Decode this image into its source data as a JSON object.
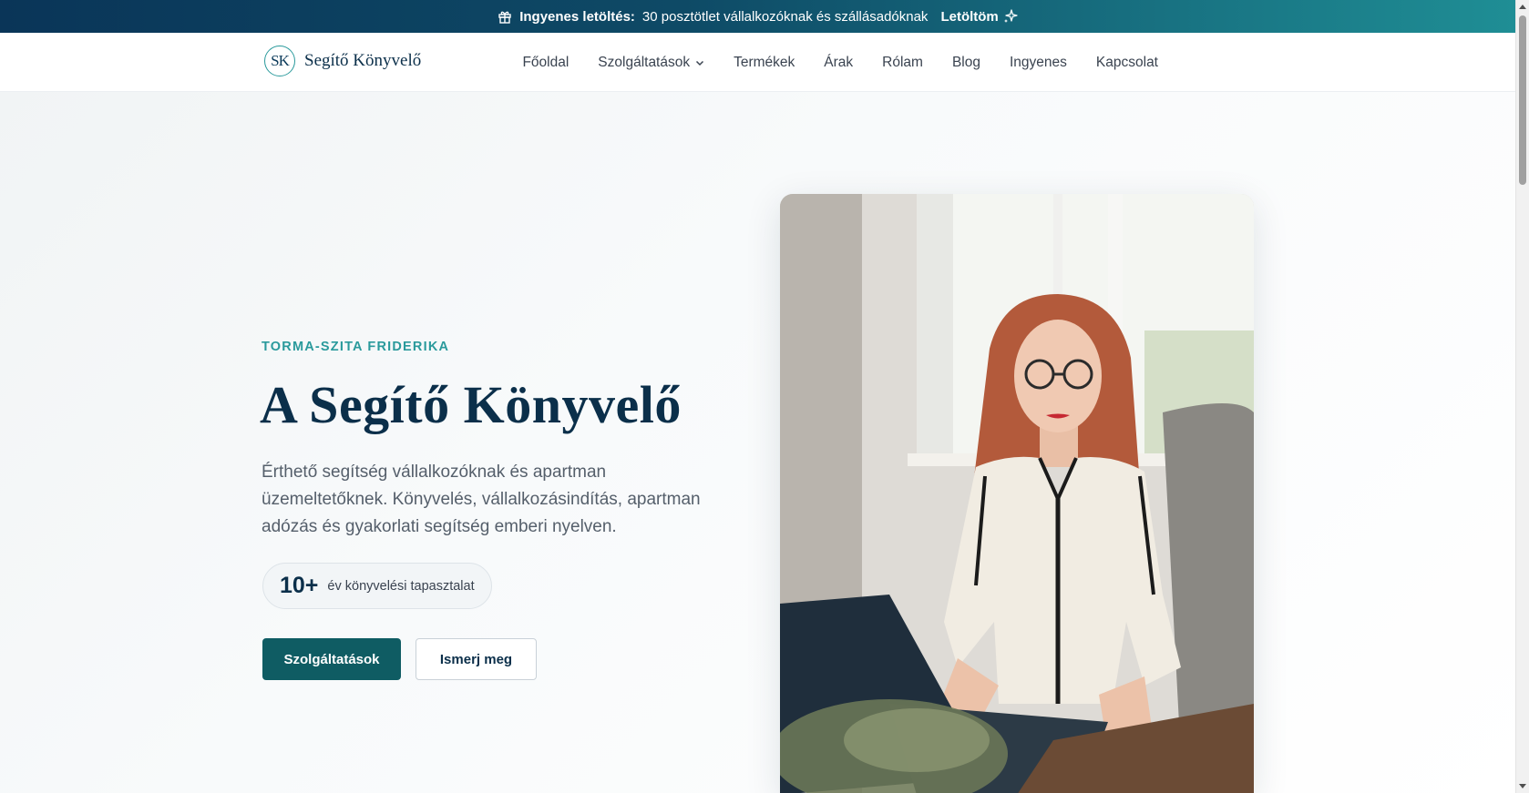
{
  "announcement": {
    "bold": "Ingyenes letöltés:",
    "text": "30 posztötlet vállalkozóknak és szállásadóknak",
    "cta": "Letöltöm"
  },
  "brand": {
    "monogram": "SK",
    "name": "Segítő Könyvelő"
  },
  "nav": {
    "items": [
      {
        "label": "Főoldal"
      },
      {
        "label": "Szolgáltatások"
      },
      {
        "label": "Termékek"
      },
      {
        "label": "Árak"
      },
      {
        "label": "Rólam"
      },
      {
        "label": "Blog"
      },
      {
        "label": "Ingyenes"
      },
      {
        "label": "Kapcsolat"
      }
    ]
  },
  "hero": {
    "eyebrow": "TORMA-SZITA FRIDERIKA",
    "title": "A Segítő Könyvelő",
    "lead": "Érthető segítség vállalkozóknak és apartman üzemeltetőknek. Könyvelés, vállalkozásindítás, apartman adózás és gyakorlati segítség emberi nyelven.",
    "badge_number": "10+",
    "badge_text": "év könyvelési tapasztalat",
    "primary_button": "Szolgáltatások",
    "secondary_button": "Ismerj meg"
  },
  "colors": {
    "brand_dark": "#0b2f4a",
    "accent_teal": "#2a9a9c",
    "button_primary": "#0f5c63"
  },
  "icons": {
    "gift": "gift-icon",
    "sparkle": "sparkle-icon",
    "dropdown": "chevron-down-icon"
  }
}
